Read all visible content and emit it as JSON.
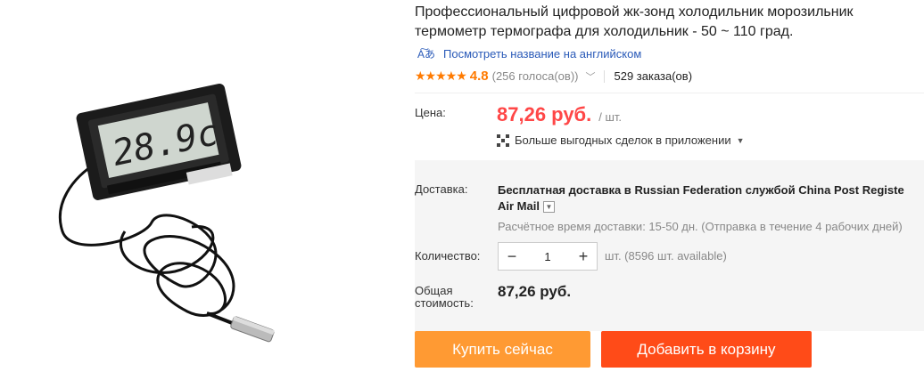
{
  "product": {
    "title_line1": "Профессиональный цифровой жк-зонд холодильник морозильник",
    "title_line2": "термометр термографа для холодильник - 50 ~ 110 град.",
    "translate_link": "Посмотреть название на английском",
    "translate_icon": "translate-icon",
    "rating_stars": "★★★★★",
    "rating_score": "4.8",
    "votes": "(256 голоса(ов))",
    "orders": "529 заказа(ов)",
    "display_reading": "28.9c"
  },
  "price": {
    "label": "Цена:",
    "value": "87,26 руб.",
    "per_unit": "/ шт.",
    "app_deals": "Больше выгодных сделок в приложении"
  },
  "shipping": {
    "label": "Доставка:",
    "line_prefix": "Бесплатная доставка в",
    "country": "Russian Federation",
    "via": "службой",
    "carrier": "China Post Registe",
    "carrier_line2": "Air Mail",
    "estimate": "Расчётное время доставки: 15-50 дн. (Отправка в течение 4 рабочих дней)"
  },
  "quantity": {
    "label": "Количество:",
    "minus": "−",
    "value": "1",
    "plus": "+",
    "available": "шт. (8596 шт. available)"
  },
  "total": {
    "label_line1": "Общая",
    "label_line2": "стоимость:",
    "value": "87,26 руб."
  },
  "actions": {
    "buy_now": "Купить сейчас",
    "add_to_cart": "Добавить в корзину"
  },
  "colors": {
    "accent_orange": "#ff4747",
    "buy_button": "#ff9a33",
    "cart_button": "#ff4b18",
    "link_blue": "#2a5ab8"
  }
}
